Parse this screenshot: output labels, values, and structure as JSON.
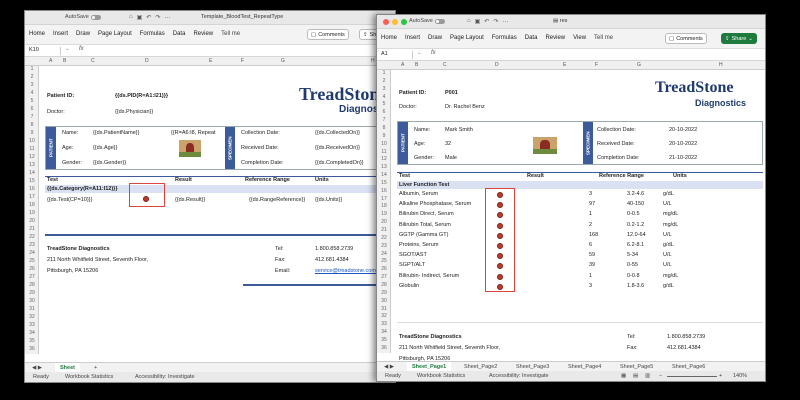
{
  "left": {
    "autosave_label": "AutoSave",
    "doc_title": "Template_BloodTest_RepeatType",
    "tabs": [
      "Home",
      "Insert",
      "Draw",
      "Page Layout",
      "Formulas",
      "Data",
      "Review"
    ],
    "tell_me": "Tell me",
    "comments_label": "Comments",
    "share_label": "Sh",
    "name_box": "K10",
    "fx": "fx",
    "columns": [
      "A",
      "B",
      "C",
      "D",
      "E",
      "F",
      "G",
      "H"
    ],
    "rows": [
      "1",
      "2",
      "3",
      "4",
      "5",
      "6",
      "7",
      "8",
      "9",
      "10",
      "11",
      "12",
      "13",
      "14",
      "15",
      "16",
      "17",
      "18",
      "19",
      "20",
      "21",
      "22",
      "23",
      "24",
      "25",
      "26",
      "27",
      "28",
      "29",
      "30",
      "31",
      "32",
      "33",
      "34",
      "35",
      "36"
    ],
    "patient_id_label": "Patient ID:",
    "patient_id_value": "{{ds.PID(R=A1:I21)}}",
    "doctor_label": "Doctor:",
    "doctor_value": "{{ds.Physician}}",
    "brand_name": "TreadStone",
    "brand_sub": "Diagnostic",
    "patient_tag": "PATIENT",
    "specimen_tag": "SPECIMEN",
    "name_label": "Name:",
    "name_value": "{{ds.PatientName}}",
    "photo_value": "{{R=A6:I8, Repeat",
    "age_label": "Age:",
    "age_value": "{{ds.Age}}",
    "gender_label": "Gender:",
    "gender_value": "{{ds.Gender}}",
    "collection_label": "Collection Date:",
    "collection_value": "{{ds.CollectedOn}}",
    "received_label": "Received Date:",
    "received_value": "{{ds.ReceivedOn}}",
    "completion_label": "Completion Date:",
    "completion_value": "{{ds.CompletedOn}}",
    "h_test": "Test",
    "h_result": "Result",
    "h_ref": "Reference Range",
    "h_units": "Units",
    "category": "{{ds.Category(R=A11:I12)}}",
    "test_row": "{{ds.Test(CP=10)}}",
    "result_row": "{{ds.Result}}",
    "ref_row": "{{ds.RangeReference}}",
    "units_row": "{{ds.Units}}",
    "footer_name": "TreadStone Diagnostics",
    "footer_addr1": "211 North Whitfield Street, Seventh Floor,",
    "footer_addr2": "Pittsburgh, PA 15206",
    "tel_label": "Tel:",
    "tel_value": "1.800.858.2739",
    "fax_label": "Fax:",
    "fax_value": "412.681.4384",
    "email_label": "Email:",
    "email_value": "service@treadstone.com",
    "sheet_tab": "Sheet",
    "add_sheet": "+",
    "status_ready": "Ready",
    "status_stats": "Workbook Statistics",
    "status_access": "Accessibility: Investigate"
  },
  "right": {
    "autosave_label": "AutoSave",
    "doc_title": "res",
    "tabs": [
      "Home",
      "Insert",
      "Draw",
      "Page Layout",
      "Formulas",
      "Data",
      "Review",
      "View"
    ],
    "tell_me": "Tell me",
    "comments_label": "Comments",
    "share_label": "Share",
    "name_box": "A1",
    "fx": "fx",
    "columns": [
      "A",
      "B",
      "C",
      "D",
      "E",
      "F",
      "G",
      "H"
    ],
    "rows": [
      "1",
      "2",
      "3",
      "4",
      "5",
      "6",
      "7",
      "8",
      "9",
      "10",
      "11",
      "12",
      "13",
      "14",
      "15",
      "16",
      "17",
      "18",
      "19",
      "20",
      "21",
      "22",
      "23",
      "24",
      "25",
      "26",
      "27",
      "28",
      "29",
      "30",
      "31",
      "32",
      "33",
      "34",
      "35",
      "36"
    ],
    "patient_id_label": "Patient ID:",
    "patient_id_value": "P001",
    "doctor_label": "Doctor:",
    "doctor_value": "Dr. Rachel Benz",
    "brand_name": "TreadStone",
    "brand_sub": "Diagnostics",
    "patient_tag": "PATIENT",
    "specimen_tag": "SPECIMEN",
    "name_label": "Name:",
    "name_value": "Mark Smith",
    "age_label": "Age:",
    "age_value": "32",
    "gender_label": "Gender:",
    "gender_value": "Male",
    "collection_label": "Collection Date:",
    "collection_value": "20-10-2022",
    "received_label": "Received Date:",
    "received_value": "20-10-2022",
    "completion_label": "Completion Date:",
    "completion_value": "21-10-2022",
    "h_test": "Test",
    "h_result": "Result",
    "h_ref": "Reference Range",
    "h_units": "Units",
    "category": "Liver Function Test",
    "tests": [
      {
        "name": "Albumin, Serum",
        "result": "3",
        "range": "3.2-4.6",
        "unit": "g/dL"
      },
      {
        "name": "Alkaline Phosphatase, Serum",
        "result": "97",
        "range": "40-150",
        "unit": "U/L"
      },
      {
        "name": "Bilirubin Direct, Serum",
        "result": "1",
        "range": "0-0.5",
        "unit": "mg/dL"
      },
      {
        "name": "Bilirubin Total, Serum",
        "result": "2",
        "range": "0.2-1.2",
        "unit": "mg/dL"
      },
      {
        "name": "GGTP (Gamma GT)",
        "result": "168",
        "range": "12.0-64",
        "unit": "U/L"
      },
      {
        "name": "Proteins, Serum",
        "result": "6",
        "range": "6.2-8.1",
        "unit": "g/dL"
      },
      {
        "name": "SGOT/AST",
        "result": "59",
        "range": "5-34",
        "unit": "U/L"
      },
      {
        "name": "SGPT/ALT",
        "result": "39",
        "range": "0-55",
        "unit": "U/L"
      },
      {
        "name": "Bilirubin- Indirect, Serum",
        "result": "1",
        "range": "0-0.8",
        "unit": "mg/dL"
      },
      {
        "name": "Globulin",
        "result": "3",
        "range": "1.8-3.6",
        "unit": "g/dL"
      }
    ],
    "footer_name": "TreadStone Diagnostics",
    "footer_addr1": "211 North Whitfield Street, Seventh Floor,",
    "footer_addr2": "Pittsburgh, PA 15206",
    "tel_label": "Tel:",
    "tel_value": "1.800.858.2739",
    "fax_label": "Fax:",
    "fax_value": "412.681.4384",
    "email_label": "Email:",
    "email_value": "service@treadstone.com",
    "sheet_tabs": [
      "Sheet_Page1",
      "Sheet_Page2",
      "Sheet_Page3",
      "Sheet_Page4",
      "Sheet_Page5",
      "Sheet_Page6"
    ],
    "status_ready": "Ready",
    "status_stats": "Workbook Statistics",
    "status_access": "Accessibility: Investigate",
    "zoom": "140%"
  },
  "colors": {
    "brand_blue": "#1f3b6e",
    "accent_blue": "#3b5b9a",
    "excel_green": "#1f7a3d",
    "marker_red": "#c0392b",
    "highlight_red": "#d9463a"
  }
}
